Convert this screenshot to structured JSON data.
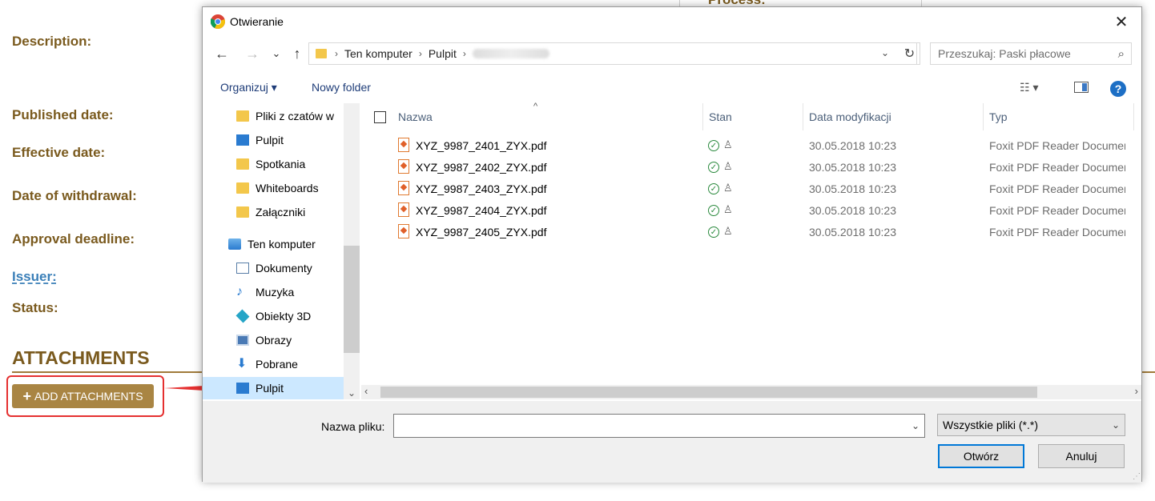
{
  "page": {
    "process_label": "Process:",
    "fields": {
      "description": "Description:",
      "published": "Published date:",
      "effective": "Effective date:",
      "withdrawal": "Date of withdrawal:",
      "approval": "Approval deadline:",
      "issuer": "Issuer:",
      "status": "Status:"
    },
    "attachments_heading": "ATTACHMENTS",
    "add_button": "ADD ATTACHMENTS",
    "add_button_icon": "+"
  },
  "dialog": {
    "title": "Otwieranie",
    "nav": {
      "back": "←",
      "forward": "→",
      "recent": "⌄",
      "up": "↑"
    },
    "breadcrumb": [
      "Ten komputer",
      "Pulpit"
    ],
    "search_placeholder": "Przeszukaj: Paski płacowe",
    "toolbar": {
      "organize": "Organizuj ▾",
      "new_folder": "Nowy folder"
    },
    "sidebar": [
      {
        "label": "Pliki z czatów w",
        "icon": "folder-icon"
      },
      {
        "label": "Pulpit",
        "icon": "desktop-icon"
      },
      {
        "label": "Spotkania",
        "icon": "folder-icon"
      },
      {
        "label": "Whiteboards",
        "icon": "folder-icon"
      },
      {
        "label": "Załączniki",
        "icon": "folder-icon"
      },
      {
        "label": "Ten komputer",
        "icon": "computer-icon"
      },
      {
        "label": "Dokumenty",
        "icon": "documents-icon"
      },
      {
        "label": "Muzyka",
        "icon": "music-icon"
      },
      {
        "label": "Obiekty 3D",
        "icon": "cube-icon"
      },
      {
        "label": "Obrazy",
        "icon": "pictures-icon"
      },
      {
        "label": "Pobrane",
        "icon": "download-icon"
      },
      {
        "label": "Pulpit",
        "icon": "desktop-icon"
      }
    ],
    "columns": {
      "name": "Nazwa",
      "status": "Stan",
      "modified": "Data modyfikacji",
      "type": "Typ"
    },
    "files": [
      {
        "name": "XYZ_9987_2401_ZYX.pdf",
        "modified": "30.05.2018 10:23",
        "type": "Foxit PDF Reader Document"
      },
      {
        "name": "XYZ_9987_2402_ZYX.pdf",
        "modified": "30.05.2018 10:23",
        "type": "Foxit PDF Reader Document"
      },
      {
        "name": "XYZ_9987_2403_ZYX.pdf",
        "modified": "30.05.2018 10:23",
        "type": "Foxit PDF Reader Document"
      },
      {
        "name": "XYZ_9987_2404_ZYX.pdf",
        "modified": "30.05.2018 10:23",
        "type": "Foxit PDF Reader Document"
      },
      {
        "name": "XYZ_9987_2405_ZYX.pdf",
        "modified": "30.05.2018 10:23",
        "type": "Foxit PDF Reader Document"
      }
    ],
    "filename_label": "Nazwa pliku:",
    "filename_value": "",
    "filetype": "Wszystkie pliki (*.*)",
    "open_button": "Otwórz",
    "cancel_button": "Anuluj"
  },
  "colors": {
    "brand": "#a98543",
    "label": "#7a5a1e",
    "accent": "#0078d7",
    "arrow": "#e53030"
  }
}
